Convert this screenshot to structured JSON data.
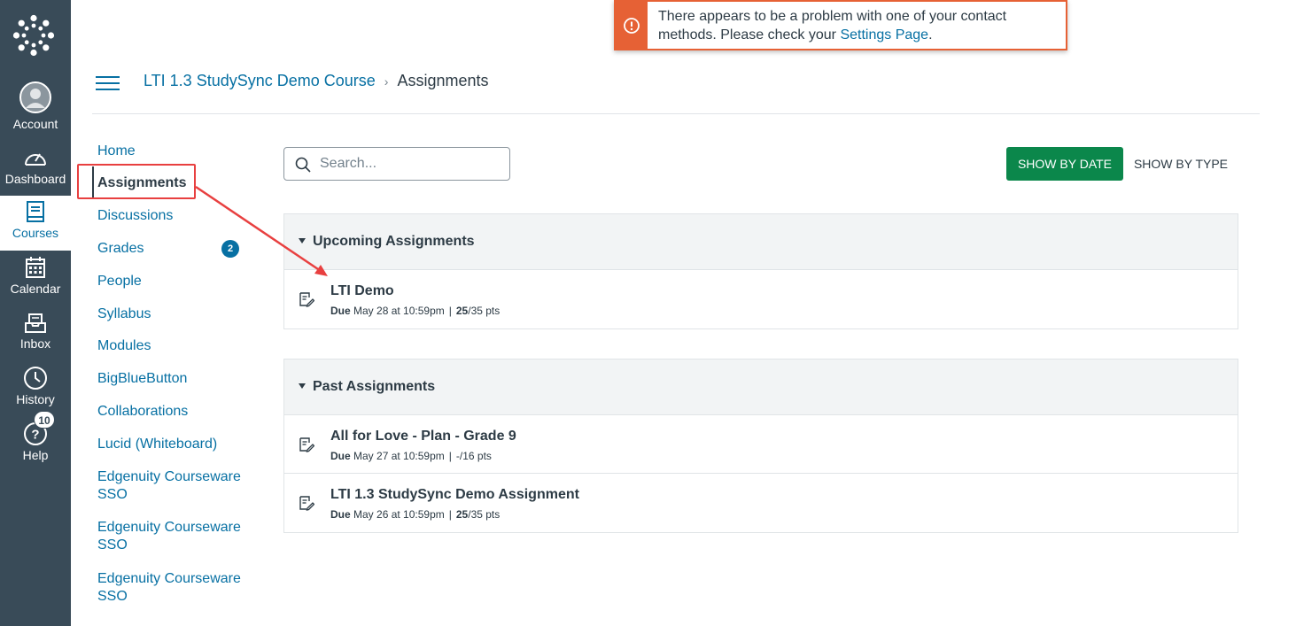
{
  "global_nav": {
    "items": [
      {
        "label": "Account",
        "icon": "account-icon"
      },
      {
        "label": "Dashboard",
        "icon": "dashboard-icon"
      },
      {
        "label": "Courses",
        "icon": "courses-icon"
      },
      {
        "label": "Calendar",
        "icon": "calendar-icon"
      },
      {
        "label": "Inbox",
        "icon": "inbox-icon"
      },
      {
        "label": "History",
        "icon": "history-icon"
      },
      {
        "label": "Help",
        "icon": "help-icon",
        "badge": "10"
      }
    ]
  },
  "alert": {
    "text_before": "There appears to be a problem with one of your contact methods. Please check your ",
    "link": "Settings Page",
    "text_after": "."
  },
  "breadcrumb": {
    "course": "LTI 1.3 StudySync Demo Course",
    "separator": "›",
    "current": "Assignments"
  },
  "course_nav": {
    "items": [
      {
        "label": "Home"
      },
      {
        "label": "Assignments"
      },
      {
        "label": "Discussions"
      },
      {
        "label": "Grades",
        "badge": "2"
      },
      {
        "label": "People"
      },
      {
        "label": "Syllabus"
      },
      {
        "label": "Modules"
      },
      {
        "label": "BigBlueButton"
      },
      {
        "label": "Collaborations"
      },
      {
        "label": "Lucid (Whiteboard)"
      },
      {
        "label": "Edgenuity Courseware SSO"
      },
      {
        "label": "Edgenuity Courseware SSO"
      },
      {
        "label": "Edgenuity Courseware SSO"
      }
    ]
  },
  "toolbar": {
    "search_placeholder": "Search...",
    "show_by_date": "SHOW BY DATE",
    "show_by_type": "SHOW BY TYPE"
  },
  "groups": [
    {
      "title": "Upcoming Assignments",
      "assignments": [
        {
          "title": "LTI Demo",
          "due_label": "Due",
          "due": "May 28 at 10:59pm",
          "score": "25",
          "points": "/35 pts"
        }
      ]
    },
    {
      "title": "Past Assignments",
      "assignments": [
        {
          "title": "All for Love - Plan - Grade 9",
          "due_label": "Due",
          "due": "May 27 at 10:59pm",
          "score": "-",
          "points": "/16 pts"
        },
        {
          "title": "LTI 1.3 StudySync Demo Assignment",
          "due_label": "Due",
          "due": "May 26 at 10:59pm",
          "score": "25",
          "points": "/35 pts"
        }
      ]
    }
  ],
  "colors": {
    "nav_bg": "#394b58",
    "link": "#0770a3",
    "alert": "#e66135",
    "primary_button": "#0b874b",
    "annotation": "#e84040"
  }
}
